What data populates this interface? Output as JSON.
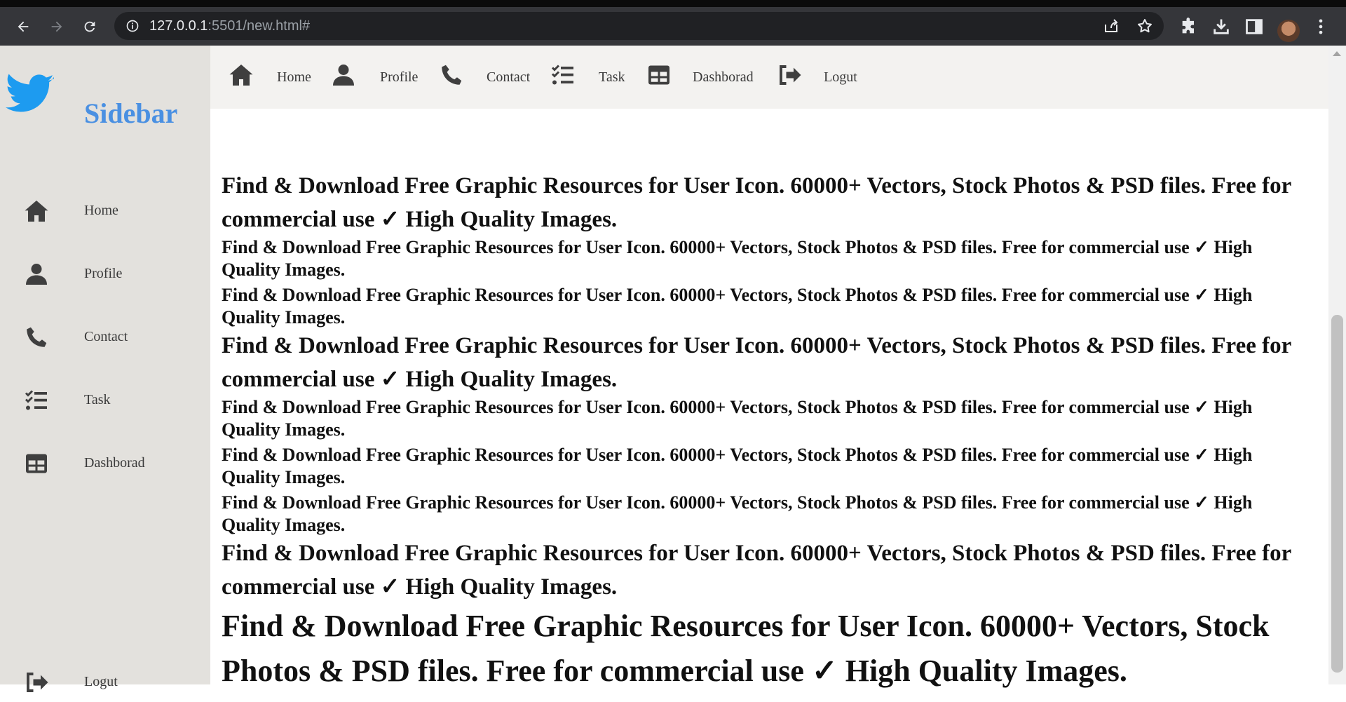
{
  "browser": {
    "url_host": "127.0.0.1",
    "url_rest": ":5501/new.html#"
  },
  "sidebar": {
    "brand": "Sidebar",
    "items": [
      {
        "label": "Home",
        "icon": "home-icon"
      },
      {
        "label": "Profile",
        "icon": "user-icon"
      },
      {
        "label": "Contact",
        "icon": "phone-icon"
      },
      {
        "label": "Task",
        "icon": "task-list-icon"
      },
      {
        "label": "Dashborad",
        "icon": "dashboard-table-icon"
      },
      {
        "label": "Logut",
        "icon": "logout-icon"
      }
    ]
  },
  "topnav": {
    "items": [
      {
        "label": "Home"
      },
      {
        "label": "Profile"
      },
      {
        "label": "Contact"
      },
      {
        "label": "Task"
      },
      {
        "label": "Dashborad"
      },
      {
        "label": "Logut"
      }
    ]
  },
  "content": {
    "paragraphs": [
      "Find & Download Free Graphic Resources for User Icon. 60000+ Vectors, Stock Photos & PSD files. Free for commercial use ✓ High Quality Images.",
      "Find & Download Free Graphic Resources for User Icon. 60000+ Vectors, Stock Photos & PSD files. Free for commercial use ✓ High Quality Images.",
      "Find & Download Free Graphic Resources for User Icon. 60000+ Vectors, Stock Photos & PSD files. Free for commercial use ✓ High Quality Images.",
      "Find & Download Free Graphic Resources for User Icon. 60000+ Vectors, Stock Photos & PSD files. Free for commercial use ✓ High Quality Images.",
      "Find & Download Free Graphic Resources for User Icon. 60000+ Vectors, Stock Photos & PSD files. Free for commercial use ✓ High Quality Images.",
      "Find & Download Free Graphic Resources for User Icon. 60000+ Vectors, Stock Photos & PSD files. Free for commercial use ✓ High Quality Images.",
      "Find & Download Free Graphic Resources for User Icon. 60000+ Vectors, Stock Photos & PSD files. Free for commercial use ✓ High Quality Images.",
      "Find & Download Free Graphic Resources for User Icon. 60000+ Vectors, Stock Photos & PSD files. Free for commercial use ✓ High Quality Images.",
      "Find & Download Free Graphic Resources for User Icon. 60000+ Vectors, Stock Photos & PSD files. Free for commercial use ✓ High Quality Images."
    ]
  },
  "colors": {
    "brand": "#4a90e2",
    "sidebar_bg": "#e3e1dd",
    "topbar_bg": "#f3f2f0",
    "icon": "#3f3f3f"
  }
}
